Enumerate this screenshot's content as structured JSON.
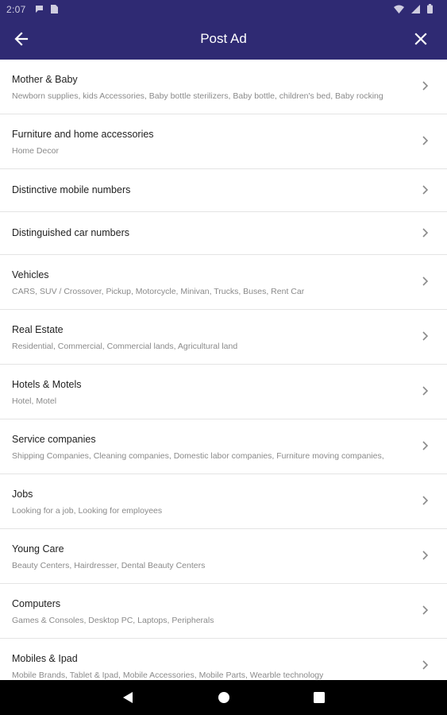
{
  "status_bar": {
    "time": "2:07",
    "icons": [
      "message-icon",
      "sim-icon",
      "wifi-icon",
      "signal-icon",
      "battery-icon"
    ]
  },
  "toolbar": {
    "title": "Post Ad",
    "back_icon": "arrow-left-icon",
    "close_icon": "close-icon"
  },
  "categories": [
    {
      "title": "Mother & Baby",
      "subtitle": "Newborn supplies, kids Accessories, Baby bottle sterilizers, Baby bottle, children's bed, Baby rocking"
    },
    {
      "title": "Furniture and home accessories",
      "subtitle": "Home Decor"
    },
    {
      "title": "Distinctive mobile numbers",
      "subtitle": ""
    },
    {
      "title": "Distinguished car numbers",
      "subtitle": ""
    },
    {
      "title": "Vehicles",
      "subtitle": "CARS, SUV / Crossover, Pickup, Motorcycle, Minivan, Trucks, Buses, Rent Car"
    },
    {
      "title": "Real Estate",
      "subtitle": "Residential, Commercial, Commercial lands, Agricultural land"
    },
    {
      "title": "Hotels & Motels",
      "subtitle": "Hotel, Motel"
    },
    {
      "title": "Service companies",
      "subtitle": "Shipping Companies, Cleaning companies, Domestic labor companies, Furniture moving companies,"
    },
    {
      "title": "Jobs",
      "subtitle": "Looking for a job, Looking for employees"
    },
    {
      "title": "Young Care",
      "subtitle": "Beauty Centers, Hairdresser, Dental Beauty Centers"
    },
    {
      "title": "Computers",
      "subtitle": "Games & Consoles, Desktop PC, Laptops, Peripherals"
    },
    {
      "title": "Mobiles & Ipad",
      "subtitle": "Mobile Brands, Tablet & Ipad, Mobile Accessories, Mobile Parts, Wearble technology"
    }
  ],
  "nav_bar": {
    "icons": [
      "back-triangle-icon",
      "home-circle-icon",
      "recents-square-icon"
    ]
  },
  "colors": {
    "header": "#2f2a73",
    "divider": "#e4e4e4",
    "title_text": "#222222",
    "subtitle_text": "#8a8a8a"
  }
}
